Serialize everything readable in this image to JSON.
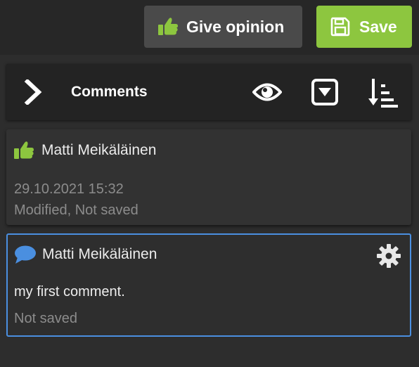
{
  "toolbar": {
    "give_opinion_label": "Give opinion",
    "save_label": "Save",
    "save_color": "#8dc63f"
  },
  "panel": {
    "title": "Comments",
    "icons": [
      "chevron-right-icon",
      "eye-icon",
      "filter-dropdown-icon",
      "sort-icon"
    ]
  },
  "comments": [
    {
      "type": "opinion",
      "icon": "thumbs-up-icon",
      "author": "Matti Meikäläinen",
      "timestamp": "29.10.2021 15:32",
      "status": "Modified, Not saved"
    },
    {
      "type": "comment",
      "icon": "speech-bubble-icon",
      "author": "Matti Meikäläinen",
      "text": "my first comment.",
      "status": "Not saved",
      "selected": true
    }
  ],
  "colors": {
    "accent_green": "#8dc63f",
    "accent_blue": "#4a8fe0"
  }
}
